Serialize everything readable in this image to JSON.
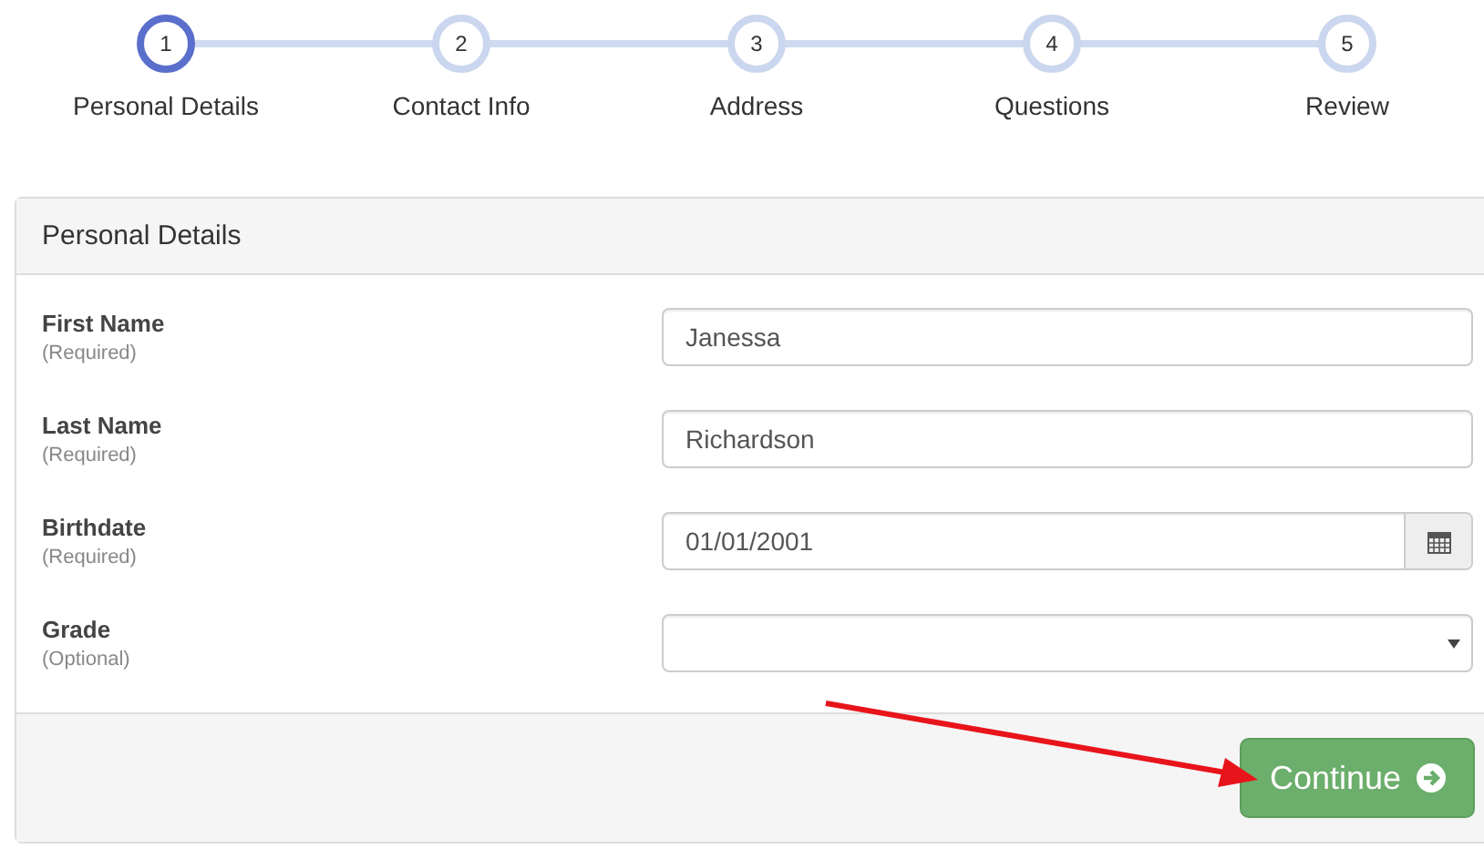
{
  "steps": [
    {
      "number": "1",
      "label": "Personal Details",
      "selected": true
    },
    {
      "number": "2",
      "label": "Contact Info",
      "selected": false
    },
    {
      "number": "3",
      "label": "Address",
      "selected": false
    },
    {
      "number": "4",
      "label": "Questions",
      "selected": false
    },
    {
      "number": "5",
      "label": "Review",
      "selected": false
    }
  ],
  "panel": {
    "title": "Personal Details",
    "fields": [
      {
        "kind": "text",
        "label": "First Name",
        "note": "(Required)",
        "value": "Janessa"
      },
      {
        "kind": "text",
        "label": "Last Name",
        "note": "(Required)",
        "value": "Richardson"
      },
      {
        "kind": "date",
        "label": "Birthdate",
        "note": "(Required)",
        "value": "01/01/2001"
      },
      {
        "kind": "select",
        "label": "Grade",
        "note": "(Optional)"
      }
    ],
    "button": "Continue"
  }
}
